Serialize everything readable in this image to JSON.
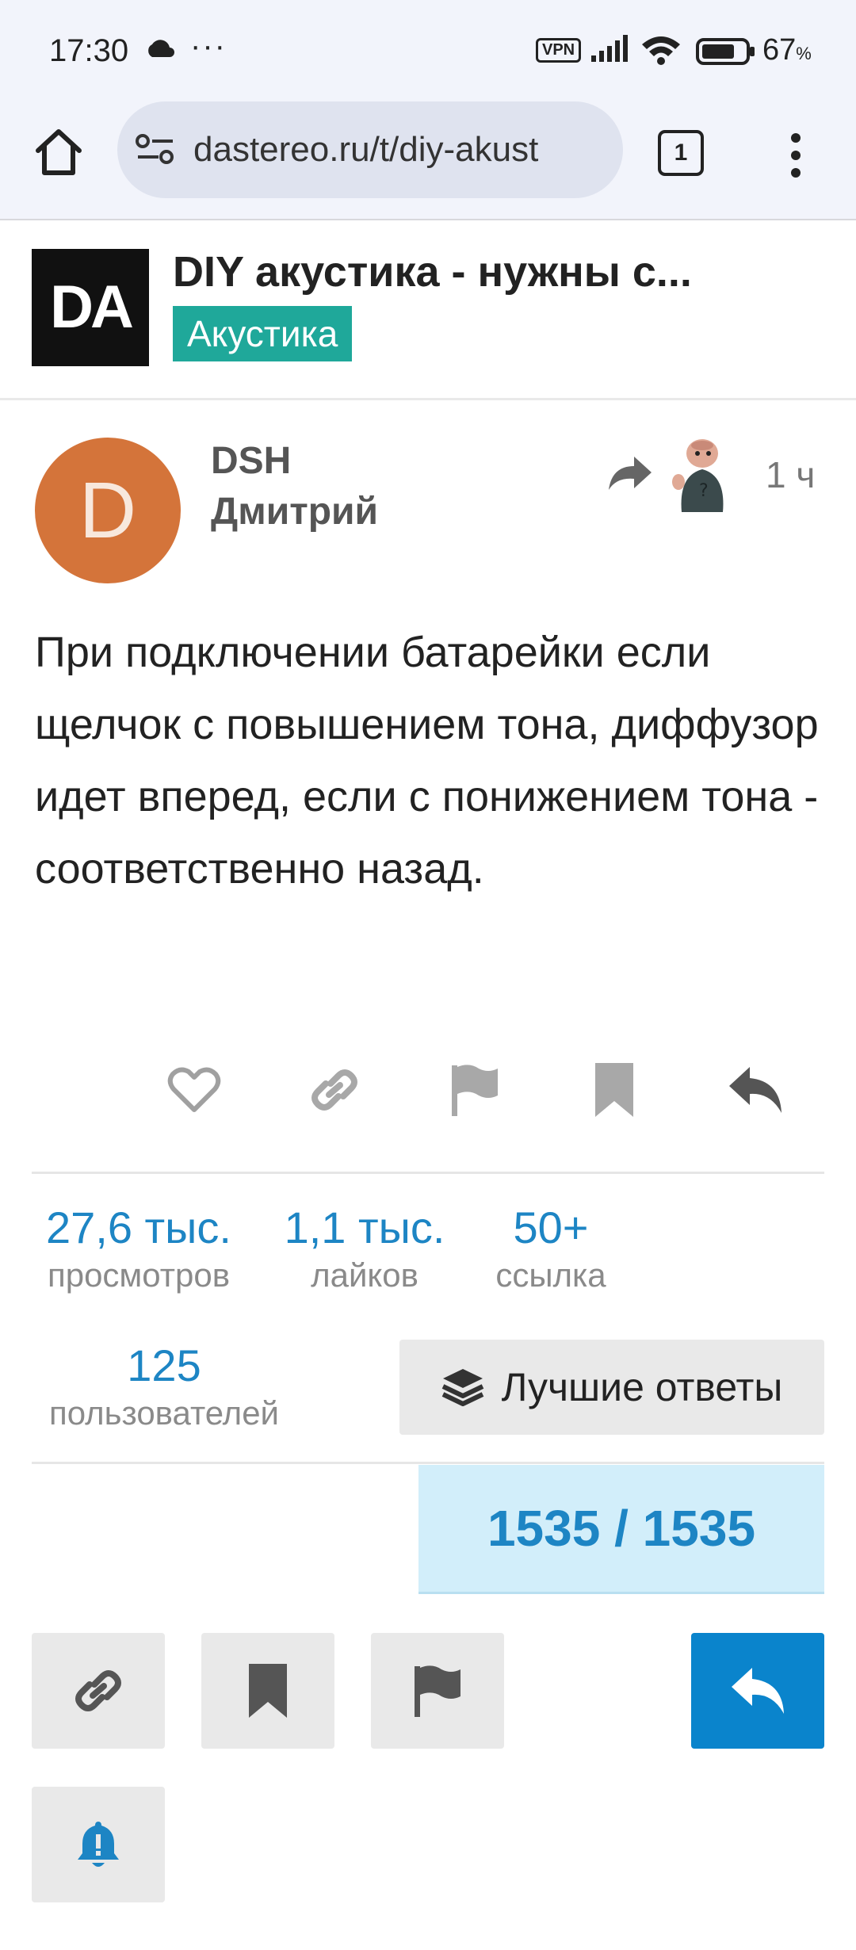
{
  "status_bar": {
    "time": "17:30",
    "dots": "···",
    "vpn": "VPN",
    "battery_percent": "67",
    "battery_unit": "%"
  },
  "browser": {
    "url": "dastereo.ru/t/diy-akust",
    "tab_count": "1"
  },
  "topic": {
    "logo_text": "DA",
    "title": "DIY акустика - нужны с...",
    "category": "Акустика",
    "category_color": "#1fa89a"
  },
  "post": {
    "avatar_letter": "D",
    "avatar_color": "#d4743a",
    "username": "DSH",
    "full_name": "Дмитрий",
    "age": "1 ч",
    "body": "При подключении батарейки если щелчок с повышением тона, диффузор идет вперед, если с понижением тона - соответственно назад."
  },
  "stats": {
    "views_value": "27,6 тыс.",
    "views_label": "просмотров",
    "likes_value": "1,1 тыс.",
    "likes_label": "лайков",
    "links_value": "50+",
    "links_label": "ссылка",
    "users_value": "125",
    "users_label": "пользователей",
    "best_answers_label": "Лучшие ответы"
  },
  "progress": {
    "current": 1535,
    "total": 1535,
    "text": "1535 / 1535"
  },
  "colors": {
    "accent": "#0a84cc",
    "stat_blue": "#1d85c4"
  },
  "icons": {
    "like": "heart-icon",
    "share": "link-icon",
    "flag": "flag-icon",
    "bookmark": "bookmark-icon",
    "reply": "reply-icon",
    "notifications": "bell-icon",
    "best_answers": "layers-icon"
  }
}
